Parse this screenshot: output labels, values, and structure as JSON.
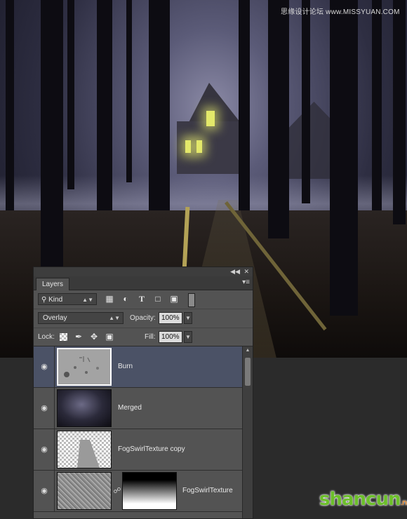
{
  "watermark": "思缘设计论坛  www.MISSYUAN.COM",
  "panel": {
    "collapse_icon": "double-chevron-left-icon",
    "close_icon": "close-icon",
    "tab_label": "Layers",
    "menu_icon": "panel-menu-icon",
    "filter": {
      "kind_label": "Kind",
      "icons": [
        "image-filter-icon",
        "adjustment-filter-icon",
        "type-filter-icon",
        "shape-filter-icon",
        "smart-object-filter-icon"
      ]
    },
    "blend_mode": "Overlay",
    "opacity_label": "Opacity:",
    "opacity_value": "100%",
    "lock_label": "Lock:",
    "lock_icons": [
      "lock-transparent-icon",
      "lock-image-icon",
      "lock-position-icon",
      "lock-all-icon"
    ],
    "fill_label": "Fill:",
    "fill_value": "100%",
    "layers": [
      {
        "name": "Burn",
        "selected": true,
        "thumb": "burn"
      },
      {
        "name": "Merged",
        "selected": false,
        "thumb": "merged"
      },
      {
        "name": "FogSwirlTexture copy",
        "selected": false,
        "thumb": "fog"
      },
      {
        "name": "FogSwirlTexture",
        "selected": false,
        "thumb": "noise",
        "has_mask": true
      }
    ]
  },
  "logo": {
    "text": "shancun",
    "suffix": ".net"
  }
}
